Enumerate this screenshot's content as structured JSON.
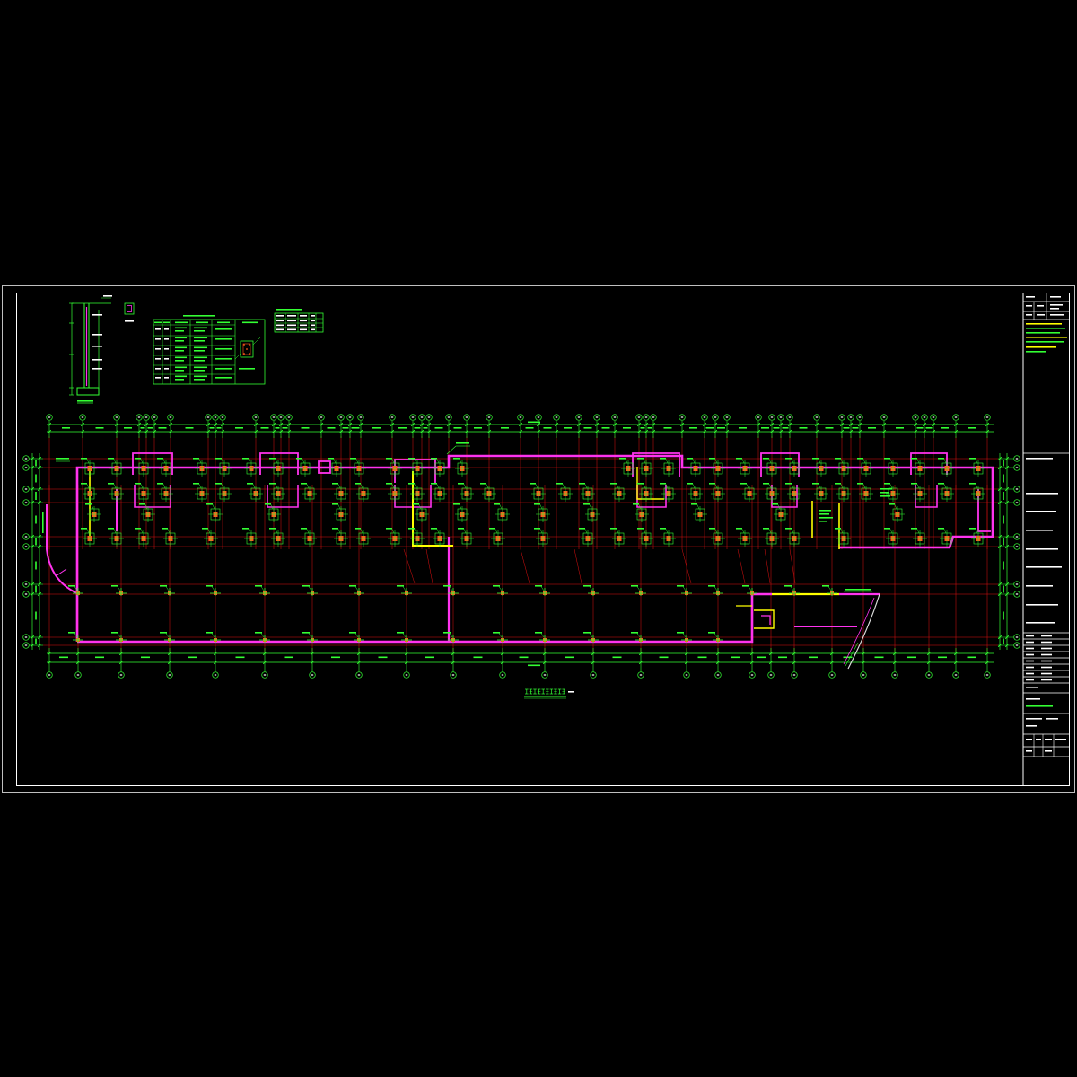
{
  "drawing": {
    "colors": {
      "background": "#000000",
      "frame": "#ffffff",
      "frame_outer": "#bfbfbf",
      "wall": "#ff33ee",
      "axis": "#e01010",
      "dimension": "#33ff33",
      "highlight": "#ffff00",
      "column_fill": "#ff5a1a",
      "text": "#ffffff",
      "ramp": "#dddddd"
    }
  }
}
